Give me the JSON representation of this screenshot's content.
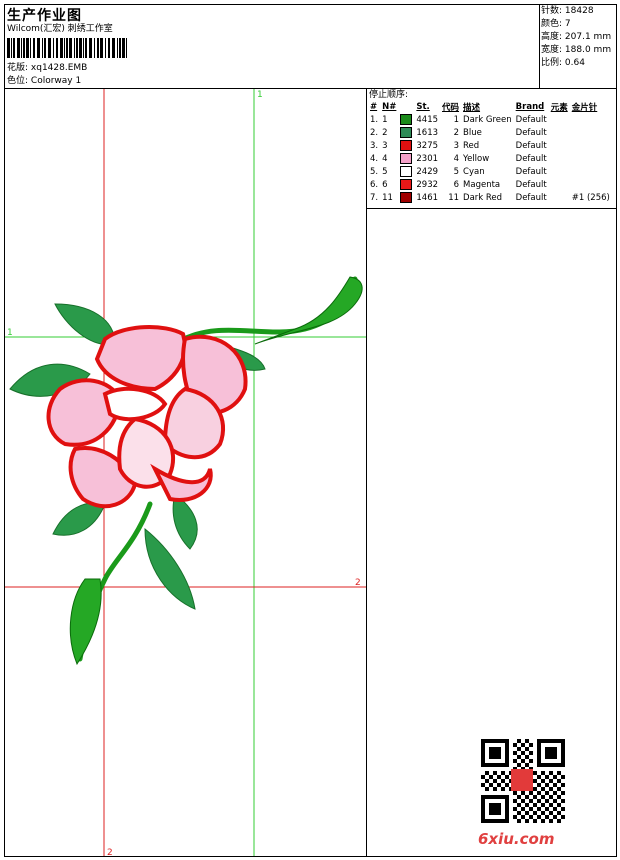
{
  "header": {
    "title": "生产作业图",
    "company": "Wilcom(汇宏) 刺绣工作室",
    "design_label": "花版:",
    "design_value": "xq1428.EMB",
    "colorway_label": "色位:",
    "colorway_value": "Colorway 1"
  },
  "stats": [
    {
      "label": "针数:",
      "value": "18428"
    },
    {
      "label": "颜色:",
      "value": "7"
    },
    {
      "label": "高度:",
      "value": "207.1 mm"
    },
    {
      "label": "宽度:",
      "value": "188.0 mm"
    },
    {
      "label": "比例:",
      "value": "0.64"
    }
  ],
  "stop_sequence": {
    "title": "停止顺序:",
    "headers": [
      "#",
      "N#",
      "St.",
      "代码",
      "描述",
      "Brand",
      "元素",
      "金片针"
    ],
    "rows": [
      {
        "idx": "1.",
        "n": "1",
        "color": "#1a8a1a",
        "st": "4415",
        "code": "1",
        "desc": "Dark Green",
        "brand": "Default",
        "extra": ""
      },
      {
        "idx": "2.",
        "n": "2",
        "color": "#2e8b57",
        "st": "1613",
        "code": "2",
        "desc": "Blue",
        "brand": "Default",
        "extra": ""
      },
      {
        "idx": "3.",
        "n": "3",
        "color": "#e01010",
        "st": "3275",
        "code": "3",
        "desc": "Red",
        "brand": "Default",
        "extra": ""
      },
      {
        "idx": "4.",
        "n": "4",
        "color": "#f4a0c8",
        "st": "2301",
        "code": "4",
        "desc": "Yellow",
        "brand": "Default",
        "extra": ""
      },
      {
        "idx": "5.",
        "n": "5",
        "color": "#ffffff",
        "st": "2429",
        "code": "5",
        "desc": "Cyan",
        "brand": "Default",
        "extra": ""
      },
      {
        "idx": "6.",
        "n": "6",
        "color": "#e81818",
        "st": "2932",
        "code": "6",
        "desc": "Magenta",
        "brand": "Default",
        "extra": ""
      },
      {
        "idx": "7.",
        "n": "11",
        "color": "#a00000",
        "st": "1461",
        "code": "11",
        "desc": "Dark Red",
        "brand": "Default",
        "extra": "#1 (256)"
      }
    ]
  },
  "guides": {
    "green_top": "1",
    "green_left": "1",
    "red_bottom": "2",
    "red_right": "2"
  },
  "colors": {
    "guide_green": "#33cc33",
    "guide_red": "#dd2222"
  },
  "watermark": "6xiu.com"
}
